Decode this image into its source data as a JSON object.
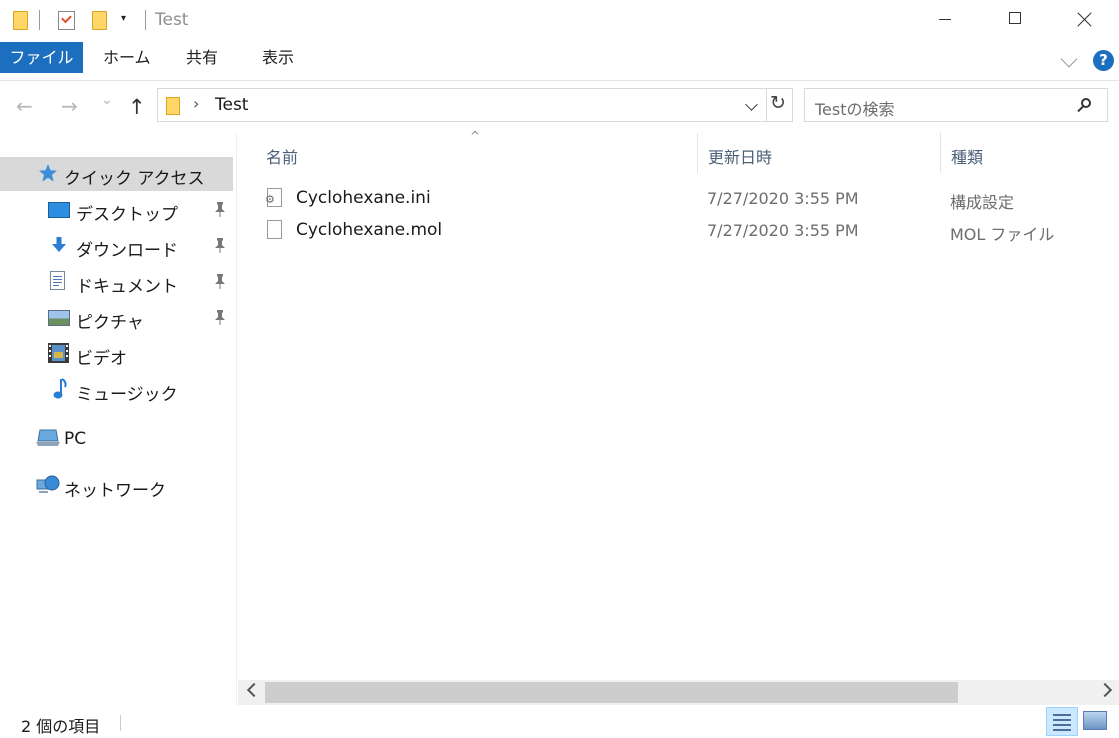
{
  "window": {
    "title": "Test",
    "quick_access": {
      "dropdown_glyph": "▾"
    }
  },
  "ribbon": {
    "tabs": [
      {
        "label": "ファイル",
        "active": true
      },
      {
        "label": "ホーム"
      },
      {
        "label": "共有"
      },
      {
        "label": "表示"
      }
    ],
    "help_label": "?"
  },
  "navigation": {
    "back_glyph": "←",
    "forward_glyph": "→",
    "recent_glyph": "⌄",
    "up_glyph": "↑",
    "address_separator": "›",
    "address_path": "Test",
    "refresh_glyph": "↻",
    "search_placeholder": "Testの検索"
  },
  "sidebar": {
    "items": [
      {
        "label": "クイック アクセス",
        "icon": "star-icon",
        "selected": true
      },
      {
        "label": "デスクトップ",
        "icon": "desktop-icon",
        "pinned": true
      },
      {
        "label": "ダウンロード",
        "icon": "download-icon",
        "pinned": true
      },
      {
        "label": "ドキュメント",
        "icon": "document-icon",
        "pinned": true
      },
      {
        "label": "ピクチャ",
        "icon": "picture-icon",
        "pinned": true
      },
      {
        "label": "ビデオ",
        "icon": "video-icon"
      },
      {
        "label": "ミュージック",
        "icon": "music-icon"
      },
      {
        "label": "PC",
        "icon": "pc-icon"
      },
      {
        "label": "ネットワーク",
        "icon": "network-icon"
      }
    ],
    "pin_glyph": "📌"
  },
  "content": {
    "columns": {
      "name": "名前",
      "modified": "更新日時",
      "type": "種類"
    },
    "sort_caret": "^",
    "files": [
      {
        "name": "Cyclohexane.ini",
        "modified": "7/27/2020 3:55 PM",
        "type": "構成設定",
        "icon": "settings-file-icon"
      },
      {
        "name": "Cyclohexane.mol",
        "modified": "7/27/2020 3:55 PM",
        "type": "MOL ファイル",
        "icon": "file-icon"
      }
    ]
  },
  "status": {
    "item_count": "2 個の項目"
  },
  "colors": {
    "accent": "#1c6ebf",
    "selection": "#d9d9d9",
    "header_text": "#4c607a"
  }
}
